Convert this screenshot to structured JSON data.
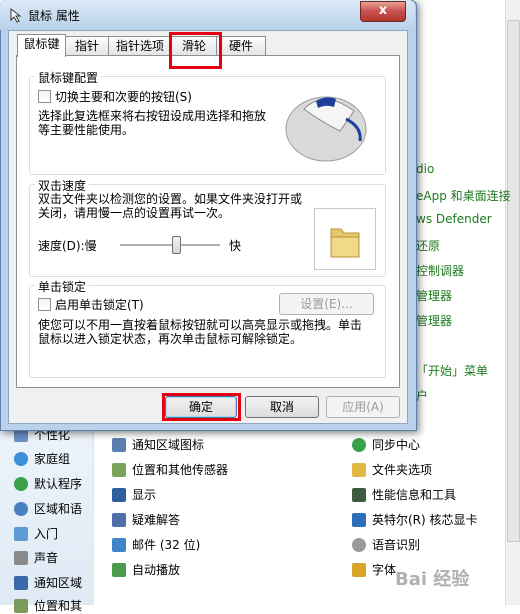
{
  "dialog": {
    "title": "鼠标 属性",
    "close_label": "x",
    "tabs": [
      "鼠标键",
      "指针",
      "指针选项",
      "滑轮",
      "硬件"
    ],
    "button_config": {
      "group_title": "鼠标键配置",
      "switch_label": "切换主要和次要的按钮(S)",
      "switch_checked": false,
      "description": "选择此复选框来将右按钮设成用选择和拖放等主要性能使用。"
    },
    "double_click": {
      "group_title": "双击速度",
      "description": "双击文件夹以检测您的设置。如果文件夹没打开或关闭，请用慢一点的设置再试一次。",
      "speed_label": "速度(D):慢",
      "fast_label": "快",
      "slider_fraction": 0.56
    },
    "click_lock": {
      "group_title": "单击锁定",
      "enable_label": "启用单击锁定(T)",
      "enable_checked": false,
      "settings_label": "设置(E)...",
      "description": "使您可以不用一直按着鼠标按钮就可以高亮显示或拖拽。单击鼠标以进入锁定状态，再次单击鼠标可解除锁定。"
    },
    "buttons": {
      "ok": "确定",
      "cancel": "取消",
      "apply": "应用(A)"
    }
  },
  "background": {
    "right_links": [
      "dio",
      "eApp 和桌面连接",
      "ws Defender",
      "还原",
      "控制调器",
      "管理器",
      "管理器",
      "「开始」菜单",
      "户"
    ],
    "left_nav": [
      "个性化",
      "家庭组",
      "默认程序",
      "区域和语",
      "入门",
      "声音",
      "通知区域",
      "位置和其"
    ],
    "col1": [
      "通知区域图标",
      "位置和其他传感器",
      "显示",
      "疑难解答",
      "邮件 (32 位)",
      "自动播放"
    ],
    "col2": [
      "同步中心",
      "文件夹选项",
      "性能信息和工具",
      "英特尔(R) 核芯显卡",
      "语音识别",
      "字体"
    ],
    "watermark": "Bai 经验"
  },
  "colors": {
    "highlight": "#e60012",
    "link_green": "#1f7a1f"
  }
}
